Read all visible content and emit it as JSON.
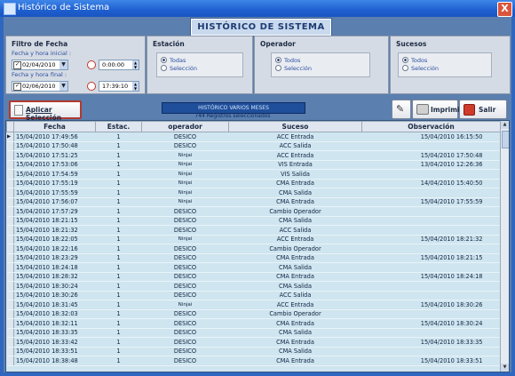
{
  "window": {
    "title": "Histórico de Sistema",
    "close_label": "X"
  },
  "banner": "HISTÓRICO DE SISTEMA",
  "filters": {
    "fecha": {
      "title": "Filtro de Fecha",
      "start_label": "Fecha y hora inicial :",
      "start_date": "02/04/2010",
      "start_time": "0:00:00",
      "end_label": "Fecha y hora final :",
      "end_date": "02/06/2010",
      "end_time": "17:39:10"
    },
    "estacion": {
      "title": "Estación",
      "opt1": "Todas",
      "opt2": "Selección"
    },
    "operador": {
      "title": "Operador",
      "opt1": "Todos",
      "opt2": "Selección"
    },
    "sucesos": {
      "title": "Sucesos",
      "opt1": "Todos",
      "opt2": "Selección"
    }
  },
  "toolbar": {
    "apply_label": "Aplicar Selección",
    "print_label": "Imprimir",
    "exit_label": "Salir",
    "status_title": "HISTÓRICO VARIOS MESES",
    "status_count": "744  Registros seleccionados"
  },
  "table": {
    "headers": [
      "Fecha",
      "Estac.",
      "operador",
      "Suceso",
      "Observación"
    ],
    "rows": [
      [
        "15/04/2010 17:49:56",
        "1",
        "DESICO",
        "ACC Entrada",
        "15/04/2010 16:15:50"
      ],
      [
        "15/04/2010 17:50:48",
        "1",
        "DESICO",
        "ACC Salida",
        ""
      ],
      [
        "15/04/2010 17:51:25",
        "1",
        "Ninjai",
        "ACC Entrada",
        "15/04/2010 17:50:48"
      ],
      [
        "15/04/2010 17:53:06",
        "1",
        "Ninjai",
        "VIS Entrada",
        "13/04/2010 12:26:36"
      ],
      [
        "15/04/2010 17:54:59",
        "1",
        "Ninjai",
        "VIS Salida",
        ""
      ],
      [
        "15/04/2010 17:55:19",
        "1",
        "Ninjai",
        "CMA Entrada",
        "14/04/2010 15:40:50"
      ],
      [
        "15/04/2010 17:55:59",
        "1",
        "Ninjai",
        "CMA Salida",
        ""
      ],
      [
        "15/04/2010 17:56:07",
        "1",
        "Ninjai",
        "CMA Entrada",
        "15/04/2010 17:55:59"
      ],
      [
        "15/04/2010 17:57:29",
        "1",
        "DESICO",
        "Cambio Operador",
        ""
      ],
      [
        "15/04/2010 18:21:15",
        "1",
        "DESICO",
        "CMA Salida",
        ""
      ],
      [
        "15/04/2010 18:21:32",
        "1",
        "DESICO",
        "ACC Salida",
        ""
      ],
      [
        "15/04/2010 18:22:05",
        "1",
        "Ninjai",
        "ACC Entrada",
        "15/04/2010 18:21:32"
      ],
      [
        "15/04/2010 18:22:16",
        "1",
        "DESICO",
        "Cambio Operador",
        ""
      ],
      [
        "15/04/2010 18:23:29",
        "1",
        "DESICO",
        "CMA Entrada",
        "15/04/2010 18:21:15"
      ],
      [
        "15/04/2010 18:24:18",
        "1",
        "DESICO",
        "CMA Salida",
        ""
      ],
      [
        "15/04/2010 18:28:32",
        "1",
        "DESICO",
        "CMA Entrada",
        "15/04/2010 18:24:18"
      ],
      [
        "15/04/2010 18:30:24",
        "1",
        "DESICO",
        "CMA Salida",
        ""
      ],
      [
        "15/04/2010 18:30:26",
        "1",
        "DESICO",
        "ACC Salida",
        ""
      ],
      [
        "15/04/2010 18:31:45",
        "1",
        "Ninjai",
        "ACC Entrada",
        "15/04/2010 18:30:26"
      ],
      [
        "15/04/2010 18:32:03",
        "1",
        "DESICO",
        "Cambio Operador",
        ""
      ],
      [
        "15/04/2010 18:32:11",
        "1",
        "DESICO",
        "CMA Entrada",
        "15/04/2010 18:30:24"
      ],
      [
        "15/04/2010 18:33:35",
        "1",
        "DESICO",
        "CMA Salida",
        ""
      ],
      [
        "15/04/2010 18:33:42",
        "1",
        "DESICO",
        "CMA Entrada",
        "15/04/2010 18:33:35"
      ],
      [
        "15/04/2010 18:33:51",
        "1",
        "DESICO",
        "CMA Salida",
        ""
      ],
      [
        "15/04/2010 18:38:48",
        "1",
        "DESICO",
        "CMA Entrada",
        "15/04/2010 18:33:51"
      ]
    ]
  }
}
